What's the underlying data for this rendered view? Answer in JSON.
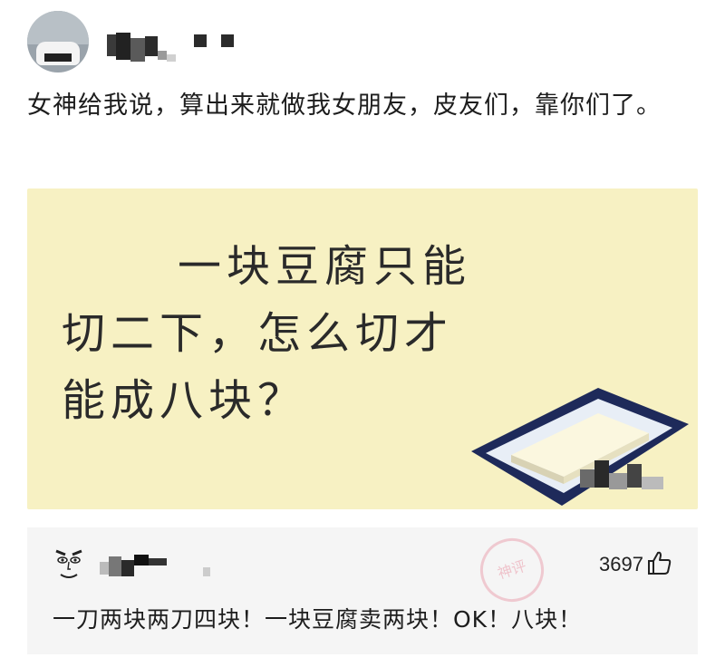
{
  "post": {
    "text": "女神给我说，算出来就做我女朋友，皮友们，靠你们了。"
  },
  "meme": {
    "line1": "一块豆腐只能",
    "line2": "切二下，怎么切才",
    "line3": "能成八块？"
  },
  "comment": {
    "likes": "3697",
    "text": "一刀两块两刀四块！一块豆腐卖两块！OK！八块！",
    "watermark": "神评"
  },
  "icons": {
    "like": "thumbs-up-icon",
    "avatar": "user-avatar",
    "commenter_avatar": "commenter-avatar"
  }
}
